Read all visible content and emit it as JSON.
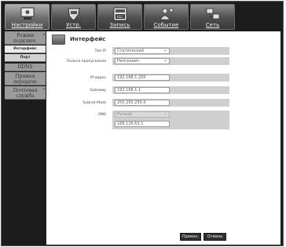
{
  "tabs": [
    {
      "label": "Настройки",
      "icon": "camera-monitor-icon",
      "active": true
    },
    {
      "label": "Устр.",
      "icon": "device-shield-icon",
      "active": false
    },
    {
      "label": "Запись",
      "icon": "record-rec-icon",
      "active": false
    },
    {
      "label": "Событие",
      "icon": "event-person-icon",
      "active": false
    },
    {
      "label": "Сеть",
      "icon": "network-icon",
      "active": false
    }
  ],
  "menu": {
    "mode": "Режим подключ.",
    "sub1": "Интерфейс",
    "sub2": "Порт",
    "ddns": "DDNS",
    "stream": "Прямая передача",
    "mail": "Почтовая служба"
  },
  "panel": {
    "title": "Интерфейс",
    "fields": {
      "ip_type": {
        "label": "Тип IP",
        "value": "Статический"
      },
      "bandwidth": {
        "label": "Полоса пропускания",
        "value": "Неогранич"
      },
      "ip": {
        "label": "IP-адрес",
        "value": "192.168.1.200"
      },
      "gateway": {
        "label": "Gateway",
        "value": "192.168.1.1"
      },
      "subnet": {
        "label": "Subnet Mask",
        "value": "255.255.255.0"
      },
      "dns": {
        "label": "DNS",
        "mode": "Ручной",
        "value": "168.126.63.1"
      }
    }
  },
  "buttons": {
    "apply": "Примен.",
    "cancel": "Отмена"
  },
  "colors": {
    "frame_bg": "#1c1c1c",
    "panel_bg": "#ffffff",
    "menu_bg": "#9b9b9b",
    "submenu_bg": "#d2d2d2",
    "field_band": "#cfcfcf",
    "button_bg": "#2f2f2f"
  }
}
